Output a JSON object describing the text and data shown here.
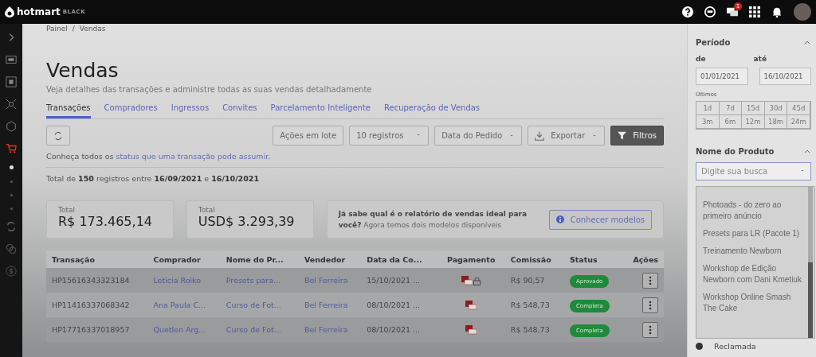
{
  "topbar": {
    "logo": "hotmart",
    "edition": "BLACK",
    "notification_count": "1"
  },
  "breadcrumb": [
    "Painel",
    "/",
    "Vendas"
  ],
  "page": {
    "title": "Vendas",
    "subtitle": "Veja detalhes das transações e administre todas as suas vendas detalhadamente"
  },
  "tabs": [
    {
      "label": "Transações",
      "selected": true
    },
    {
      "label": "Compradores",
      "selected": false
    },
    {
      "label": "Ingressos",
      "selected": false
    },
    {
      "label": "Convites",
      "selected": false
    },
    {
      "label": "Parcelamento Inteligente",
      "selected": false
    },
    {
      "label": "Recuperação de Vendas",
      "selected": false
    }
  ],
  "toolbar": {
    "batch_button": "Ações em lote",
    "page_size": "10 registros",
    "sort": "Data do Pedido",
    "export": "Exportar",
    "filters": "Filtros"
  },
  "info": {
    "text": "Conheça todos os ",
    "link": "status que uma transação pode assumir",
    "end": "."
  },
  "total_line": "Total de **150** registros entre **16/09/2021** e **16/10/2021**",
  "totals": [
    {
      "label": "Total",
      "value": "R$ 173.465,14"
    },
    {
      "label": "Total",
      "value": "USD$ 3.293,39"
    }
  ],
  "report_card": {
    "text": "**Já sabe qual é o relatório de vendas ideal para você?** Agora temos dois modelos disponíveis",
    "button": "Conhecer modelos"
  },
  "table": {
    "columns": [
      "Transação",
      "Comprador",
      "Nome do Pr...",
      "Vendedor",
      "Data da Co...",
      "Pagamento",
      "Comissão",
      "Status",
      "Ações"
    ],
    "rows": [
      {
        "transaction": "HP15616343323184",
        "buyer": "Leticia Roiko",
        "product": "Presets para...",
        "seller": "Bel Ferreira",
        "date": "15/10/2021 ...",
        "locked": true,
        "commission": "R$ 90,57",
        "status": "Aprovado",
        "color": "#1e8a3a"
      },
      {
        "transaction": "HP11416337068342",
        "buyer": "Ana Paula C...",
        "product": "Curso de Fot...",
        "seller": "Bel Ferreira",
        "date": "08/10/2021 ...",
        "locked": false,
        "commission": "R$ 548,73",
        "status": "Completa",
        "color": "#1e8a3a"
      },
      {
        "transaction": "HP17716337018957",
        "buyer": "Quetlen Arg...",
        "product": "Curso de Fot...",
        "seller": "Bel Ferreira",
        "date": "08/10/2021 ...",
        "locked": false,
        "commission": "R$ 548,73",
        "status": "Completa",
        "color": "#1e8a3a"
      }
    ]
  },
  "filters": {
    "period": {
      "title": "Período",
      "from_label": "de",
      "to_label": "até",
      "from": "01/01/2021",
      "to": "16/10/2021",
      "quick_label": "Últimos",
      "quick": [
        {
          "label": "1d",
          "selected": false
        },
        {
          "label": "7d",
          "selected": false
        },
        {
          "label": "15d",
          "selected": false
        },
        {
          "label": "30d",
          "selected": false
        },
        {
          "label": "45d",
          "selected": false
        },
        {
          "label": "3m",
          "selected": false
        },
        {
          "label": "6m",
          "selected": false
        },
        {
          "label": "12m",
          "selected": false
        },
        {
          "label": "18m",
          "selected": false
        },
        {
          "label": "24m",
          "selected": false
        }
      ]
    },
    "product": {
      "title": "Nome do Produto",
      "placeholder": "Digite sua busca",
      "options": [
        "Photoads - do zero ao primeiro anúncio",
        "Presets para LR (Pacote 1)",
        "Treinamento Newborn",
        "Workshop de Edição Newborn com Dani Kmetiuk",
        "Workshop Online Smash The Cake"
      ]
    },
    "status_options": [
      {
        "label": "Reclamada",
        "checked": false
      }
    ]
  }
}
